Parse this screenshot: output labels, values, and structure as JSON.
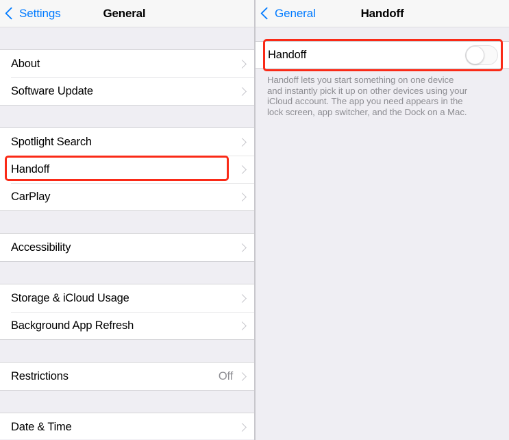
{
  "left_panel": {
    "nav": {
      "back_label": "Settings",
      "back_icon": "chevron-left-icon",
      "title": "General"
    },
    "groups": [
      {
        "rows": [
          {
            "label": "About",
            "value": "",
            "accessory": "chevron-right-icon"
          },
          {
            "label": "Software Update",
            "value": "",
            "accessory": "chevron-right-icon"
          }
        ]
      },
      {
        "rows": [
          {
            "label": "Spotlight Search",
            "value": "",
            "accessory": "chevron-right-icon"
          },
          {
            "label": "Handoff",
            "value": "",
            "accessory": "chevron-right-icon"
          },
          {
            "label": "CarPlay",
            "value": "",
            "accessory": "chevron-right-icon"
          }
        ]
      },
      {
        "rows": [
          {
            "label": "Accessibility",
            "value": "",
            "accessory": "chevron-right-icon"
          }
        ]
      },
      {
        "rows": [
          {
            "label": "Storage & iCloud Usage",
            "value": "",
            "accessory": "chevron-right-icon"
          },
          {
            "label": "Background App Refresh",
            "value": "",
            "accessory": "chevron-right-icon"
          }
        ]
      },
      {
        "rows": [
          {
            "label": "Restrictions",
            "value": "Off",
            "accessory": "chevron-right-icon"
          }
        ]
      },
      {
        "rows": [
          {
            "label": "Date & Time",
            "value": "",
            "accessory": "chevron-right-icon"
          }
        ]
      }
    ]
  },
  "right_panel": {
    "nav": {
      "back_label": "General",
      "back_icon": "chevron-left-icon",
      "title": "Handoff"
    },
    "toggle": {
      "label": "Handoff",
      "state": "off",
      "state_label": "Off"
    },
    "description": "Handoff lets you start something on one device and instantly pick it up on other devices using your iCloud account. The app you need appears in the lock screen, app switcher, and the Dock on a Mac."
  },
  "annotations": {
    "highlight_color": "#fa2a17",
    "left_target": "Handoff",
    "right_target": "Handoff"
  },
  "colors": {
    "accent_blue": "#007aff",
    "list_background": "#efeef3",
    "row_background": "#ffffff",
    "secondary_text": "#8e8e93",
    "highlight": "#fa2a17"
  }
}
